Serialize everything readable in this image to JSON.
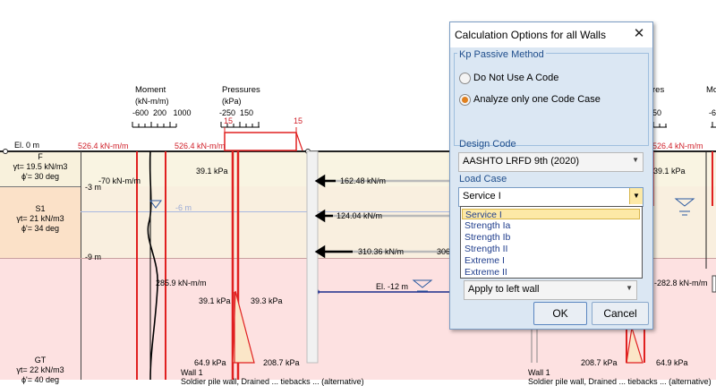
{
  "diagram": {
    "headers": {
      "moment_title": "Moment",
      "moment_units": "(kN-m/m)",
      "moment_ticks": "-600  200   1000",
      "pressures_title": "Pressures",
      "pressures_units": "(kPa)",
      "pressures_ticks": "-250  150",
      "pressures_red_ticks": "15",
      "pressure_marker_right": "15",
      "right_pressures_title": "res",
      "right_pressures_ticks": "50",
      "right_moment_title": "Mo",
      "right_moment_ticks": "-6"
    },
    "elevations": {
      "el0": "El. 0 m",
      "m3": "-3 m",
      "m9": "-9 m",
      "water_left": "-6 m",
      "el_m12": "El. -12 m"
    },
    "soils": [
      {
        "name": "F",
        "gamma": "γt= 19.5 kN/m3",
        "phi": "ϕ'= 30 deg"
      },
      {
        "name": "S1",
        "gamma": "γt= 21 kN/m3",
        "phi": "ϕ'= 34 deg"
      },
      {
        "name": "GT",
        "gamma": "γt= 22 kN/m3",
        "phi": "ϕ'= 40 deg"
      }
    ],
    "left_labels": {
      "top_moment": "526.4 kN-m/m",
      "top_moment_2": "526.4 kN-m/m",
      "moment_m3": "-70 kN-m/m",
      "kpa_top": "39.1 kPa",
      "moment_low": "285.9 kN-m/m",
      "kpa_mid_l": "39.1 kPa",
      "kpa_mid_r": "39.3 kPa",
      "kpa_bot_l": "64.9 kPa",
      "kpa_bot_r": "208.7 kPa",
      "wall": "Wall 1",
      "wall_desc": "Soldier pile wall, Drained ... tiebacks ... (alternative)"
    },
    "anchors": [
      {
        "force": "162.48 kN/m"
      },
      {
        "force": "124.04 kN/m"
      },
      {
        "force": "310.36 kN/m"
      }
    ],
    "anchor_right_partial": "306",
    "right_labels": {
      "top_moment": "526.4 kN-m/m",
      "kpa_top": "39.1 kPa",
      "moment_low": "-282.8 kN-m/m",
      "kpa_bot_l": "208.7 kPa",
      "kpa_bot_r": "64.9 kPa",
      "wall": "Wall 1",
      "wall_desc": "Soldier pile wall, Drained ... tiebacks ... (alternative)"
    }
  },
  "dialog": {
    "title": "Calculation Options for all Walls",
    "kp_group_title": "Kp Passive Method",
    "radio_options": [
      {
        "label": "Do Not Use A Code",
        "selected": false
      },
      {
        "label": "Analyze only one Code Case",
        "selected": true
      }
    ],
    "design_code_label": "Design Code",
    "design_code_value": "AASHTO LRFD 9th (2020)",
    "load_case_label": "Load Case",
    "load_case_value": "Service I",
    "load_case_options": [
      "Service I",
      "Strength Ia",
      "Strength Ib",
      "Strength II",
      "Extreme I",
      "Extreme II"
    ],
    "apply_value": "Apply to left wall",
    "ok_label": "OK",
    "cancel_label": "Cancel"
  },
  "colors": {
    "soil_f": "#f8f1dc",
    "soil_s1": "#fbe1c8",
    "soil_gt": "#fde1e1",
    "wall_red": "#e02020",
    "dialog_bg": "#dbe7f3",
    "accent_highlight": "#fde9a6"
  }
}
